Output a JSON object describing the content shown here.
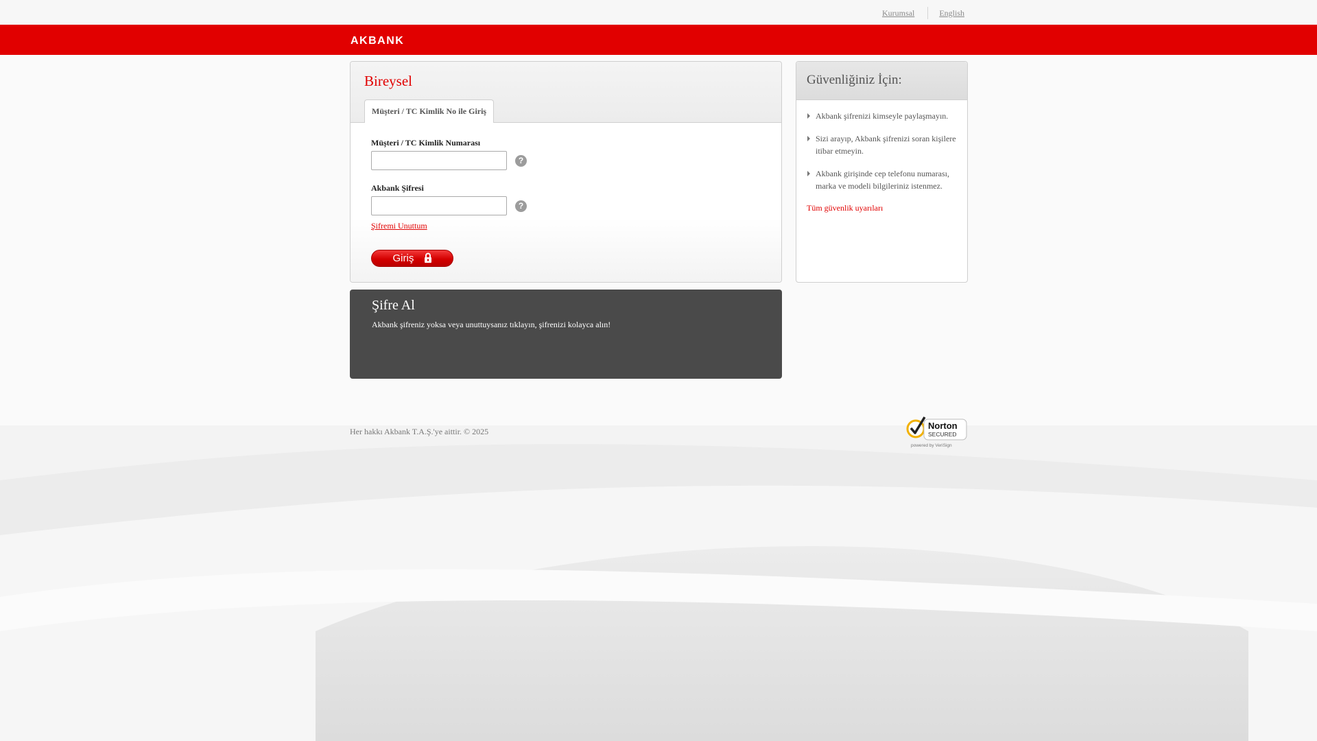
{
  "top_links": {
    "corporate": "Kurumsal",
    "english": "English"
  },
  "brand": {
    "logo_text": "AKBANK",
    "color": "#e10000"
  },
  "login_panel": {
    "title": "Bireysel",
    "tab_label": "Müşteri / TC Kimlik No ile Giriş",
    "customer_label": "Müşteri / TC Kimlik Numarası",
    "customer_value": "",
    "password_label": "Akbank Şifresi",
    "password_value": "",
    "help_icon_text": "?",
    "forgot_link": "Şifremi Unuttum",
    "login_button": "Giriş"
  },
  "security_panel": {
    "title": "Güvenliğiniz İçin:",
    "items": [
      "Akbank şifrenizi kimseyle paylaşmayın.",
      "Sizi arayıp, Akbank şifrenizi soran kişilere itibar etmeyin.",
      "Akbank girişinde cep telefonu numarası, marka ve modeli bilgileriniz istenmez."
    ],
    "all_warnings_link": "Tüm güvenlik uyarıları"
  },
  "get_password_panel": {
    "title": "Şifre Al",
    "text": "Akbank şifreniz yoksa veya unuttuysanız tıklayın, şifrenizi kolayca alın!"
  },
  "footer": {
    "copyright": "Her hakkı Akbank T.A.Ş.'ye aittir. © 2025"
  },
  "norton_badge": {
    "line1": "Norton",
    "line2": "SECURED",
    "line3": "powered by VeriSign"
  },
  "icons": {
    "help": "question-circle-icon",
    "lock": "lock-icon",
    "bullet": "triangle-right-icon",
    "badge": "checkmark-seal-icon"
  }
}
